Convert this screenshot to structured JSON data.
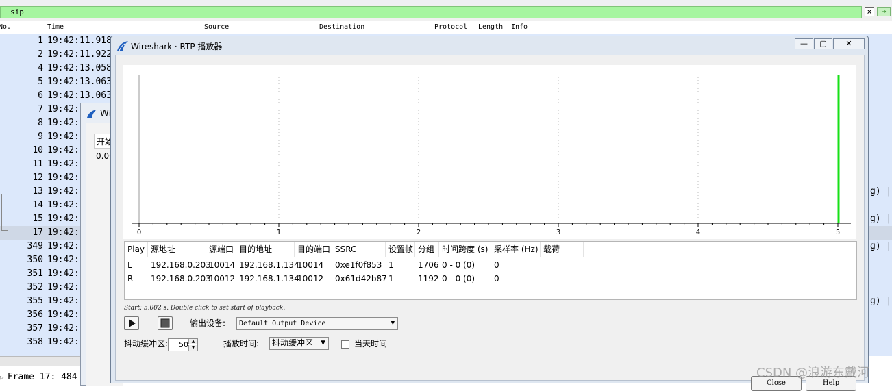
{
  "filter": {
    "value": "sip",
    "clear": "×",
    "apply": "→"
  },
  "columns": {
    "no": "No.",
    "time": "Time",
    "source": "Source",
    "destination": "Destination",
    "protocol": "Protocol",
    "length": "Length",
    "info": "Info"
  },
  "packets": [
    {
      "no": "1",
      "time": "19:42:11.918"
    },
    {
      "no": "2",
      "time": "19:42:11.922"
    },
    {
      "no": "4",
      "time": "19:42:13.058"
    },
    {
      "no": "5",
      "time": "19:42:13.063"
    },
    {
      "no": "6",
      "time": "19:42:13.063"
    },
    {
      "no": "7",
      "time": "19:42:"
    },
    {
      "no": "8",
      "time": "19:42:"
    },
    {
      "no": "9",
      "time": "19:42:"
    },
    {
      "no": "10",
      "time": "19:42:"
    },
    {
      "no": "11",
      "time": "19:42:"
    },
    {
      "no": "12",
      "time": "19:42:"
    },
    {
      "no": "13",
      "time": "19:42:"
    },
    {
      "no": "14",
      "time": "19:42:"
    },
    {
      "no": "15",
      "time": "19:42:"
    },
    {
      "no": "17",
      "time": "19:42:"
    },
    {
      "no": "349",
      "time": "19:42:"
    },
    {
      "no": "350",
      "time": "19:42:"
    },
    {
      "no": "351",
      "time": "19:42:"
    },
    {
      "no": "352",
      "time": "19:42:"
    },
    {
      "no": "355",
      "time": "19:42:"
    },
    {
      "no": "356",
      "time": "19:42:"
    },
    {
      "no": "357",
      "time": "19:42:"
    },
    {
      "no": "358",
      "time": "19:42:"
    }
  ],
  "right_fragments": [
    "g) |",
    "g) |",
    "g) |",
    "g) |"
  ],
  "detail": {
    "frame": "Frame 17: 484"
  },
  "mid_dialog": {
    "title": "Wi",
    "col": "开始",
    "val": "0.00"
  },
  "rtp": {
    "title": "Wireshark · RTP 播放器",
    "win_min": "—",
    "win_max": "▢",
    "win_close": "✕",
    "hint": "Start: 5.002 s. Double click to set start of playback.",
    "output_label": "输出设备:",
    "output_value": "Default Output Device",
    "jitter_label": "抖动缓冲区:",
    "jitter_value": "50",
    "playback_label": "播放时间:",
    "playback_value": "抖动缓冲区",
    "today_label": "当天时间",
    "close": "Close",
    "help": "Help"
  },
  "playlist": {
    "headers": [
      "Play",
      "源地址",
      "源端口",
      "目的地址",
      "目的端口",
      "SSRC",
      "设置帧",
      "分组",
      "时间跨度 (s)",
      "采样率 (Hz)",
      "载荷"
    ],
    "rows": [
      [
        "L",
        "192.168.0.203",
        "10014",
        "192.168.1.134",
        "10014",
        "0xe1f0f853",
        "1",
        "1706",
        "0 - 0 (0)",
        "0",
        ""
      ],
      [
        "R",
        "192.168.0.203",
        "10012",
        "192.168.1.134",
        "10012",
        "0x61d42b87",
        "1",
        "1192",
        "0 - 0 (0)",
        "0",
        ""
      ]
    ]
  },
  "chart_data": {
    "type": "line",
    "x_ticks": [
      "0",
      "1",
      "2",
      "3",
      "4",
      "5"
    ],
    "xlim": [
      0,
      5
    ],
    "grid": true,
    "markers": [
      {
        "x": 5,
        "color": "#18e018"
      }
    ]
  },
  "watermark": "CSDN @浪游东戴河",
  "colors": {
    "filter_bg": "#a6f5a0",
    "list_bg": "#dce8fb",
    "window_frame": "#dfe7f1",
    "playhead": "#18e018"
  }
}
